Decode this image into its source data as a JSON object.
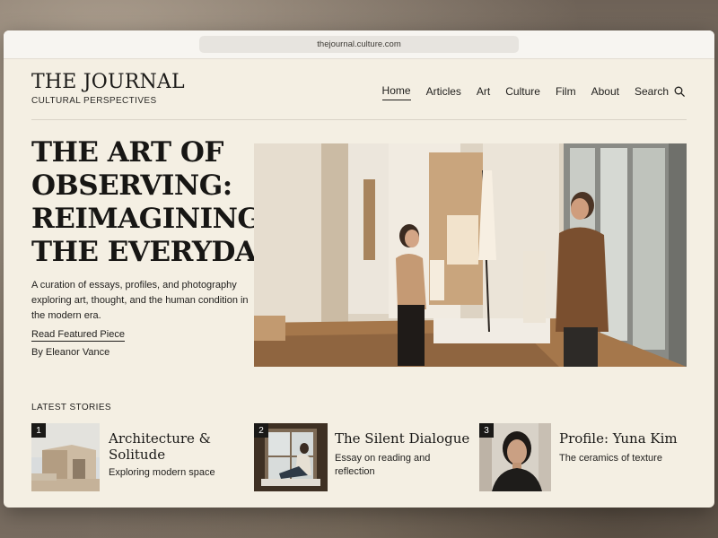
{
  "browser": {
    "url": "thejournal.culture.com"
  },
  "header": {
    "brand_name": "THE JOURNAL",
    "brand_tagline": "CULTURAL PERSPECTIVES",
    "nav": [
      {
        "label": "Home",
        "active": true
      },
      {
        "label": "Articles"
      },
      {
        "label": "Art"
      },
      {
        "label": "Culture"
      },
      {
        "label": "Film"
      },
      {
        "label": "About"
      }
    ],
    "search_label": "Search",
    "search_icon": "search-icon"
  },
  "hero": {
    "title": "THE ART OF OBSERVING: REIMAGINING THE EVERYDAY",
    "description": "A curation of essays, profiles, and photography exploring art, thought, and the human condition in the modern era.",
    "cta": "Read Featured Piece",
    "byline": "By Eleanor Vance",
    "image": "gallery-photo-two-people"
  },
  "latest": {
    "heading": "LATEST STORIES",
    "stories": [
      {
        "number": "1",
        "title": "Architecture & Solitude",
        "subtitle": "Exploring modern space",
        "image": "minimalist-building"
      },
      {
        "number": "2",
        "title": "The Silent Dialogue",
        "subtitle": "Essay on reading and reflection",
        "image": "woman-reading-by-window"
      },
      {
        "number": "3",
        "title": "Profile: Yuna Kim",
        "subtitle": "The ceramics of texture",
        "image": "portrait-woman"
      }
    ]
  },
  "colors": {
    "page_bg": "#f4efe3",
    "text": "#1a1917",
    "accent_dark": "#1a1917"
  }
}
